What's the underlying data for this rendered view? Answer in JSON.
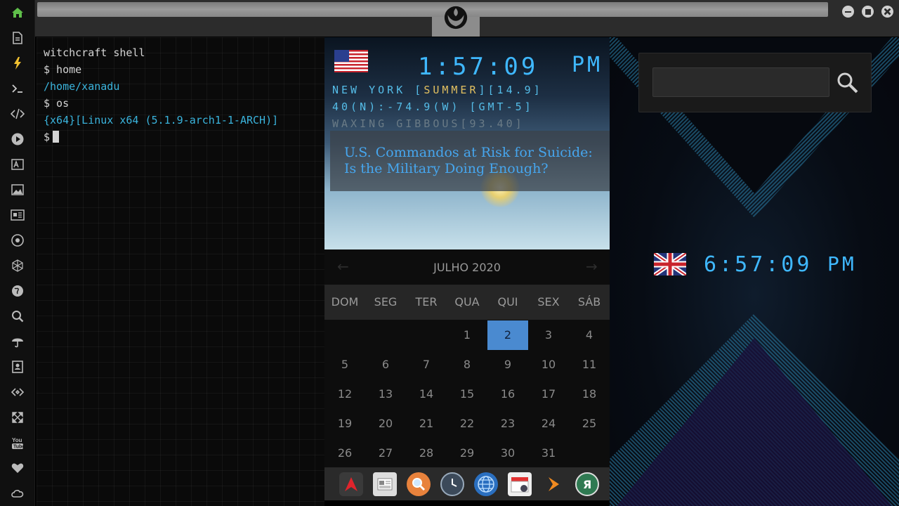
{
  "sidebar": {
    "items": [
      {
        "icon": "home-icon",
        "active": true
      },
      {
        "icon": "document-icon"
      },
      {
        "icon": "lightning-icon"
      },
      {
        "icon": "terminal-icon"
      },
      {
        "icon": "code-icon"
      },
      {
        "icon": "play-icon"
      },
      {
        "icon": "translate-icon"
      },
      {
        "icon": "image-icon"
      },
      {
        "icon": "newspaper-icon"
      },
      {
        "icon": "rebel-alliance-icon"
      },
      {
        "icon": "cube-net-icon"
      },
      {
        "icon": "globe-icon"
      },
      {
        "icon": "search-icon"
      },
      {
        "icon": "umbrella-icon"
      },
      {
        "icon": "contacts-icon"
      },
      {
        "icon": "link-icon"
      },
      {
        "icon": "expand-icon"
      },
      {
        "icon": "youtube-icon"
      },
      {
        "icon": "heart-icon"
      },
      {
        "icon": "cloud-icon"
      }
    ],
    "accent_color": "#5fbf4a"
  },
  "terminal": {
    "lines": [
      {
        "text": "witchcraft shell",
        "color": "white"
      },
      {
        "text": "$ home",
        "color": "white"
      },
      {
        "text": "/home/xanadu",
        "color": "cyan"
      },
      {
        "text": "$ os",
        "color": "white"
      },
      {
        "text": "{x64}[Linux x64 (5.1.9-arch1-1-ARCH)]",
        "color": "cyan"
      }
    ],
    "prompt": "$"
  },
  "clock_us": {
    "time": "1:57:09",
    "ampm": "PM",
    "city_before": "NEW YORK [",
    "season": "SUMMER",
    "city_after": "][14.9]",
    "coords": "40(N):-74.9(W) [GMT-5]",
    "moon": "WAXING GIBBOUS[93.40]",
    "flag": "us-flag-icon"
  },
  "news": {
    "title": "U.S. Commandos at Risk for Suicide: Is the Military Doing Enough?"
  },
  "calendar": {
    "title": "JULHO 2020",
    "prev": "←",
    "next": "→",
    "weekdays": [
      "DOM",
      "SEG",
      "TER",
      "QUA",
      "QUI",
      "SEX",
      "SÁB"
    ],
    "weeks": [
      [
        "",
        "",
        "",
        "1",
        "2",
        "3",
        "4"
      ],
      [
        "5",
        "6",
        "7",
        "8",
        "9",
        "10",
        "11"
      ],
      [
        "12",
        "13",
        "14",
        "15",
        "16",
        "17",
        "18"
      ],
      [
        "19",
        "20",
        "21",
        "22",
        "23",
        "24",
        "25"
      ],
      [
        "26",
        "27",
        "28",
        "29",
        "30",
        "31",
        ""
      ]
    ],
    "today": "2",
    "today_color": "#4a8ad0"
  },
  "dock": {
    "apps": [
      "arch-icon",
      "news-reader-icon",
      "search-app-icon",
      "clock-app-icon",
      "browser-globe-icon",
      "calendar-app-icon",
      "arrow-app-icon",
      "yandex-icon"
    ]
  },
  "search": {
    "placeholder": "",
    "value": ""
  },
  "clock_uk": {
    "time": "6:57:09",
    "ampm": "PM",
    "flag": "uk-flag-icon"
  }
}
